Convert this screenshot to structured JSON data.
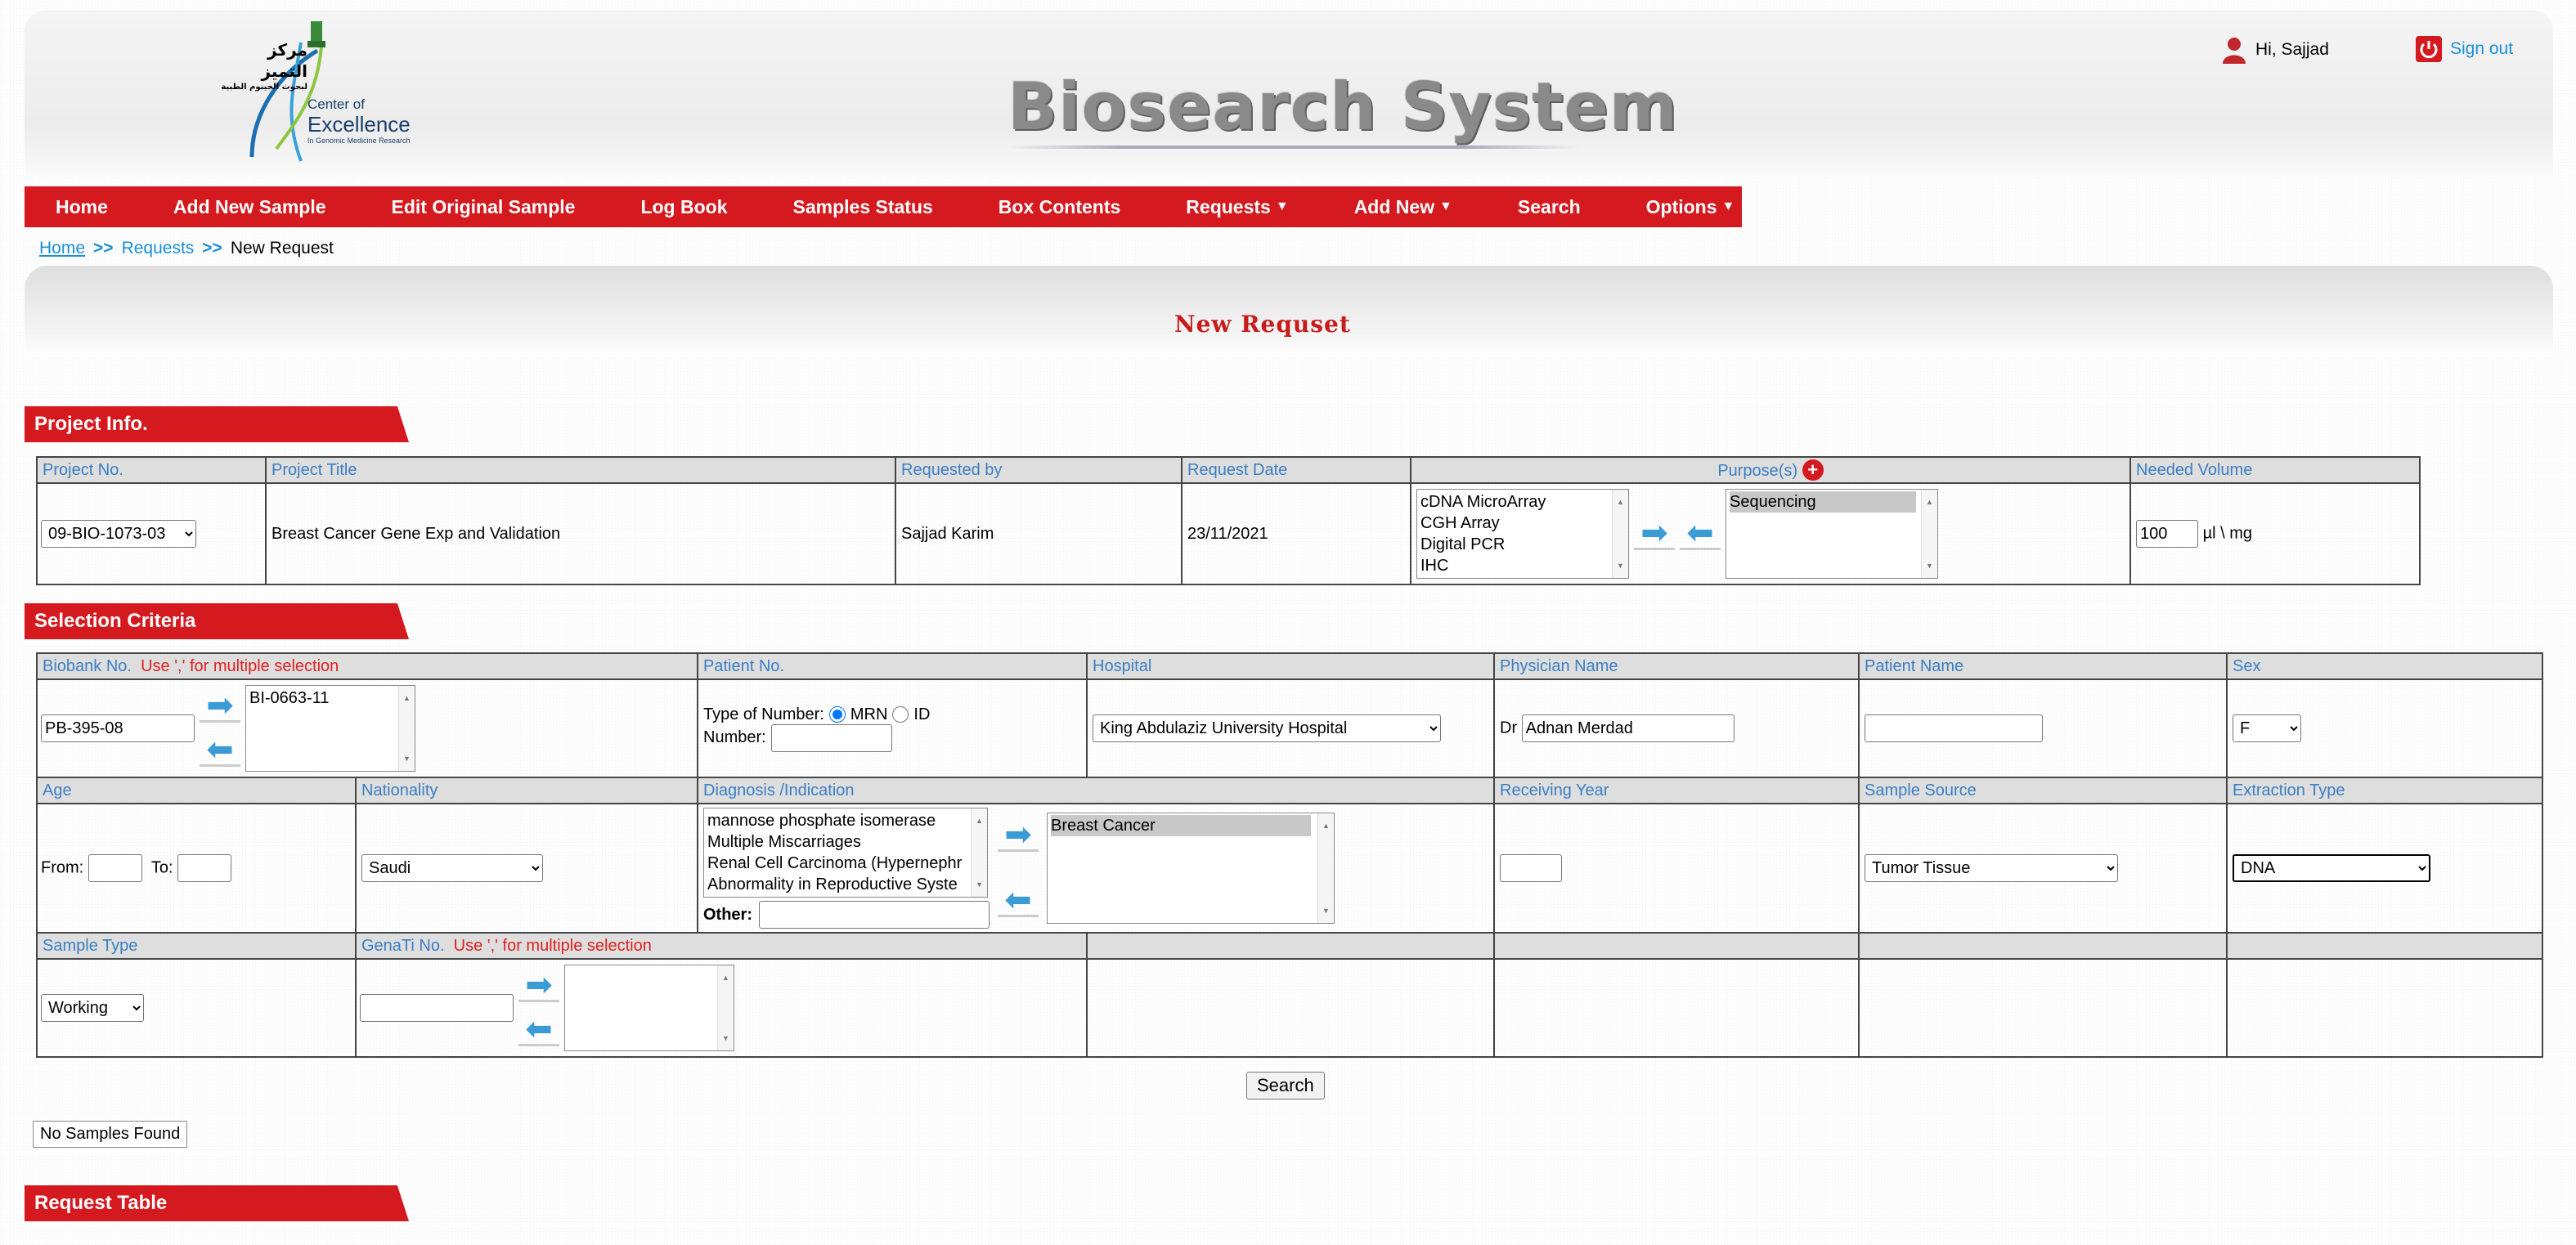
{
  "app": {
    "title": "Biosearch System",
    "logo_ar_line1": "مركز",
    "logo_ar_line2": "التميز",
    "logo_ar_line3": "لبحوث الجينوم الطبية",
    "logo_en_line1": "Center of",
    "logo_en_line2": "Excellence",
    "logo_en_line3": "In Genomic Medicine Research"
  },
  "user": {
    "greeting": "Hi, Sajjad",
    "signout": "Sign out"
  },
  "nav": [
    "Home",
    "Add New Sample",
    "Edit Original Sample",
    "Log Book",
    "Samples Status",
    "Box Contents",
    "Requests",
    "Add New",
    "Search",
    "Options"
  ],
  "breadcrumb": {
    "home": "Home",
    "sep": ">>",
    "requests": "Requests",
    "current": "New Request"
  },
  "page_title": "New Requset",
  "sections": {
    "project": "Project Info.",
    "selection": "Selection Criteria",
    "request_table": "Request Table"
  },
  "project": {
    "headers": {
      "no": "Project No.",
      "title": "Project Title",
      "requested_by": "Requested by",
      "date": "Request Date",
      "purpose": "Purpose(s)",
      "volume": "Needed Volume"
    },
    "no": "09-BIO-1073-03",
    "title": "Breast Cancer Gene Exp and Validation",
    "requested_by": "Sajjad Karim",
    "date": "23/11/2021",
    "purpose_options": [
      "cDNA MicroArray",
      "CGH Array",
      "Digital PCR",
      "IHC"
    ],
    "purpose_selected": [
      "Sequencing"
    ],
    "volume": "100",
    "volume_unit": "µl \\ mg"
  },
  "criteria": {
    "h": {
      "biobank": "Biobank No.",
      "biobank_hint": "Use ',' for multiple selection",
      "patient_no": "Patient No.",
      "hospital": "Hospital",
      "physician": "Physician Name",
      "patient_name": "Patient Name",
      "sex": "Sex",
      "age": "Age",
      "nationality": "Nationality",
      "diagnosis": "Diagnosis /Indication",
      "receiving_year": "Receiving Year",
      "sample_source": "Sample Source",
      "extraction_type": "Extraction Type",
      "sample_type": "Sample Type",
      "genati": "GenaTi No.",
      "genati_hint": "Use ',' for multiple selection"
    },
    "biobank_input": "PB-395-08",
    "biobank_selected": [
      "BI-0663-11"
    ],
    "type_of_number": "Type of Number:",
    "mrn": "MRN",
    "id": "ID",
    "number": "Number:",
    "hospital": "King Abdulaziz University Hospital",
    "dr": "Dr",
    "physician": "Adnan Merdad",
    "sex": "F",
    "from": "From:",
    "to": "To:",
    "nationality": "Saudi",
    "diagnosis_options": [
      "mannose phosphate isomerase",
      "Multiple Miscarriages",
      "Renal Cell Carcinoma (Hypernephr",
      "Abnormality in Reproductive Syste"
    ],
    "diagnosis_selected": [
      "Breast Cancer"
    ],
    "other": "Other:",
    "sample_source": "Tumor Tissue",
    "extraction_type": "DNA",
    "sample_type": "Working"
  },
  "search_button": "Search",
  "no_samples": "No Samples Found"
}
